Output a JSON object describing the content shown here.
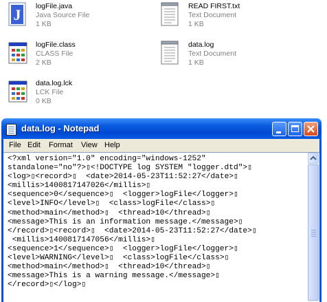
{
  "files": [
    {
      "name": "logFile.java",
      "type": "Java Source File",
      "size": "1 KB",
      "icon": "java-file-icon"
    },
    {
      "name": "READ FIRST.txt",
      "type": "Text Document",
      "size": "1 KB",
      "icon": "text-file-icon"
    },
    {
      "name": "logFile.class",
      "type": "CLASS File",
      "size": "2 KB",
      "icon": "class-file-icon"
    },
    {
      "name": "data.log",
      "type": "Text Document",
      "size": "1 KB",
      "icon": "text-file-icon"
    },
    {
      "name": "data.log.lck",
      "type": "LCK File",
      "size": "0 KB",
      "icon": "lck-file-icon"
    }
  ],
  "window": {
    "title": "data.log - Notepad",
    "menu": [
      "File",
      "Edit",
      "Format",
      "View",
      "Help"
    ],
    "content": "<?xml version=\"1.0\" encoding=\"windows-1252\"\nstandalone=\"no\"?>▯<!DOCTYPE log SYSTEM \"logger.dtd\">▯\n<log>▯<record>▯  <date>2014-05-23T11:52:27</date>▯\n<millis>1400817147026</millis>▯\n<sequence>0</sequence>▯  <logger>logFile</logger>▯\n<level>INFO</level>▯  <class>logFile</class>▯\n<method>main</method>▯  <thread>10</thread>▯\n<message>This is an information message.</message>▯\n</record>▯<record>▯  <date>2014-05-23T11:52:27</date>▯\n <millis>1400817147056</millis>▯\n<sequence>1</sequence>▯  <logger>logFile</logger>▯\n<level>WARNING</level>▯  <class>logFile</class>▯\n<method>main</method>▯  <thread>10</thread>▯\n<message>This is a warning message.</message>▯\n</record>▯</log>▯"
  },
  "colors": {
    "titlebar": "#0054e3",
    "menubar": "#ece9d8",
    "meta_text": "#808080"
  }
}
